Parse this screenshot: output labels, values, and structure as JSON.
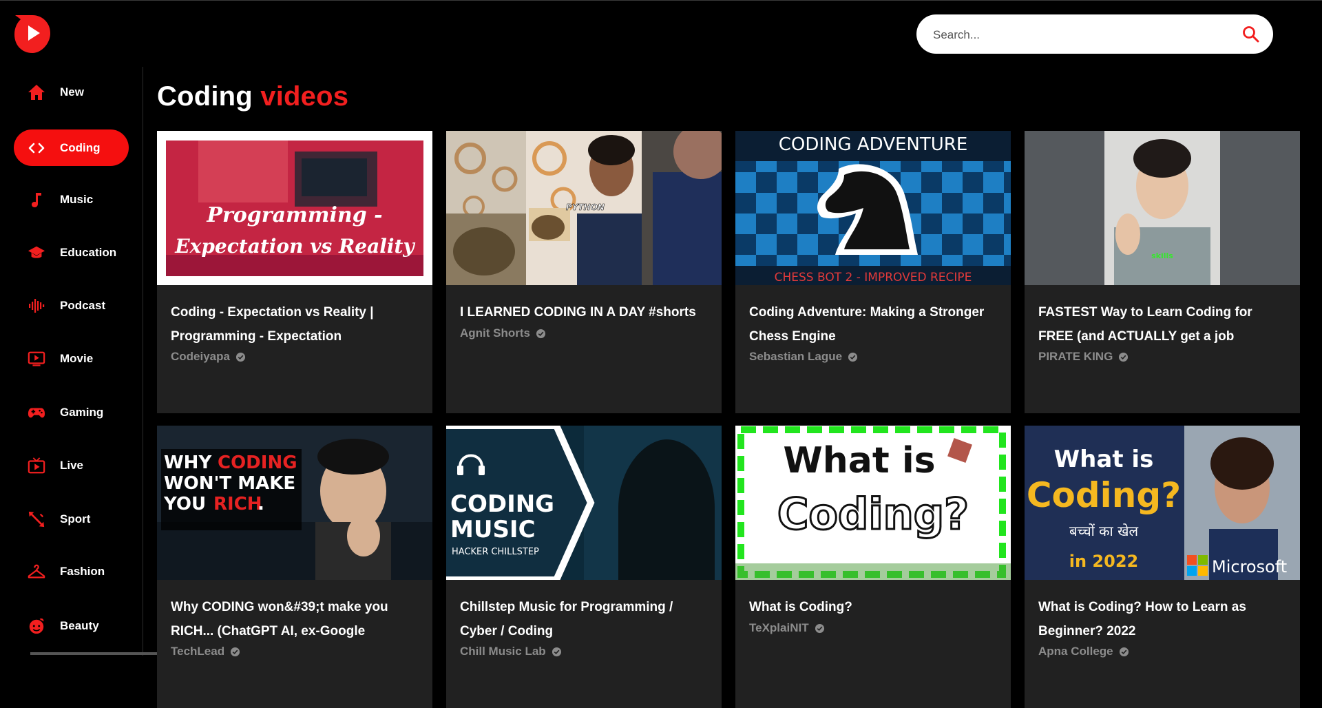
{
  "colors": {
    "accent": "#f21f1f",
    "card_bg": "#212121",
    "sidebar_active": "#f50f0f"
  },
  "search": {
    "placeholder": "Search...",
    "icon": "search-icon"
  },
  "sidebar": {
    "items": [
      {
        "label": "New",
        "icon": "home-icon",
        "active": false
      },
      {
        "label": "Coding",
        "icon": "code-icon",
        "active": true
      },
      {
        "label": "Music",
        "icon": "music-note-icon",
        "active": false
      },
      {
        "label": "Education",
        "icon": "graduation-cap-icon",
        "active": false
      },
      {
        "label": "Podcast",
        "icon": "podcast-icon",
        "active": false
      },
      {
        "label": "Movie",
        "icon": "tv-play-icon",
        "active": false
      },
      {
        "label": "Gaming",
        "icon": "gamepad-icon",
        "active": false
      },
      {
        "label": "Live",
        "icon": "live-tv-icon",
        "active": false
      },
      {
        "label": "Sport",
        "icon": "sport-icon",
        "active": false
      },
      {
        "label": "Fashion",
        "icon": "hanger-icon",
        "active": false
      },
      {
        "label": "Beauty",
        "icon": "beauty-icon",
        "active": false
      }
    ]
  },
  "page": {
    "title_main": "Coding",
    "title_accent": "videos"
  },
  "videos": [
    {
      "title": "Coding - Expectation vs Reality | Programming - Expectation",
      "channel": "Codeiyapa",
      "thumb_text": [
        "Programming -",
        "Expectation vs Reality"
      ]
    },
    {
      "title": "I LEARNED CODING IN A DAY #shorts",
      "channel": "Agnit Shorts",
      "thumb_text": [
        "PYTHON"
      ]
    },
    {
      "title": "Coding Adventure: Making a Stronger Chess Engine",
      "channel": "Sebastian Lague",
      "thumb_text": [
        "CODING ADVENTURE",
        "CHESS BOT 2 - IMPROVED RECIPE"
      ]
    },
    {
      "title": "FASTEST Way to Learn Coding for FREE (and ACTUALLY get a job",
      "channel": "PIRATE KING",
      "thumb_text": [
        "skills"
      ]
    },
    {
      "title": "Why CODING won&#39;t make you RICH... (ChatGPT AI, ex-Google",
      "channel": "TechLead",
      "thumb_text": [
        "WHY",
        "CODING",
        "WON'T MAKE",
        "YOU",
        "RICH",
        "."
      ]
    },
    {
      "title": "Chillstep Music for Programming / Cyber / Coding",
      "channel": "Chill Music Lab",
      "thumb_text": [
        "CODING",
        "MUSIC",
        "HACKER CHILLSTEP"
      ]
    },
    {
      "title": "What is Coding?",
      "channel": "TeXplaiNIT",
      "thumb_text": [
        "What is",
        "Coding?"
      ]
    },
    {
      "title": "What is Coding? How to Learn as Beginner? 2022",
      "channel": "Apna College",
      "thumb_text": [
        "What is",
        "Coding?",
        "बच्चों का खेल",
        "in 2022",
        "Microsoft"
      ]
    }
  ]
}
